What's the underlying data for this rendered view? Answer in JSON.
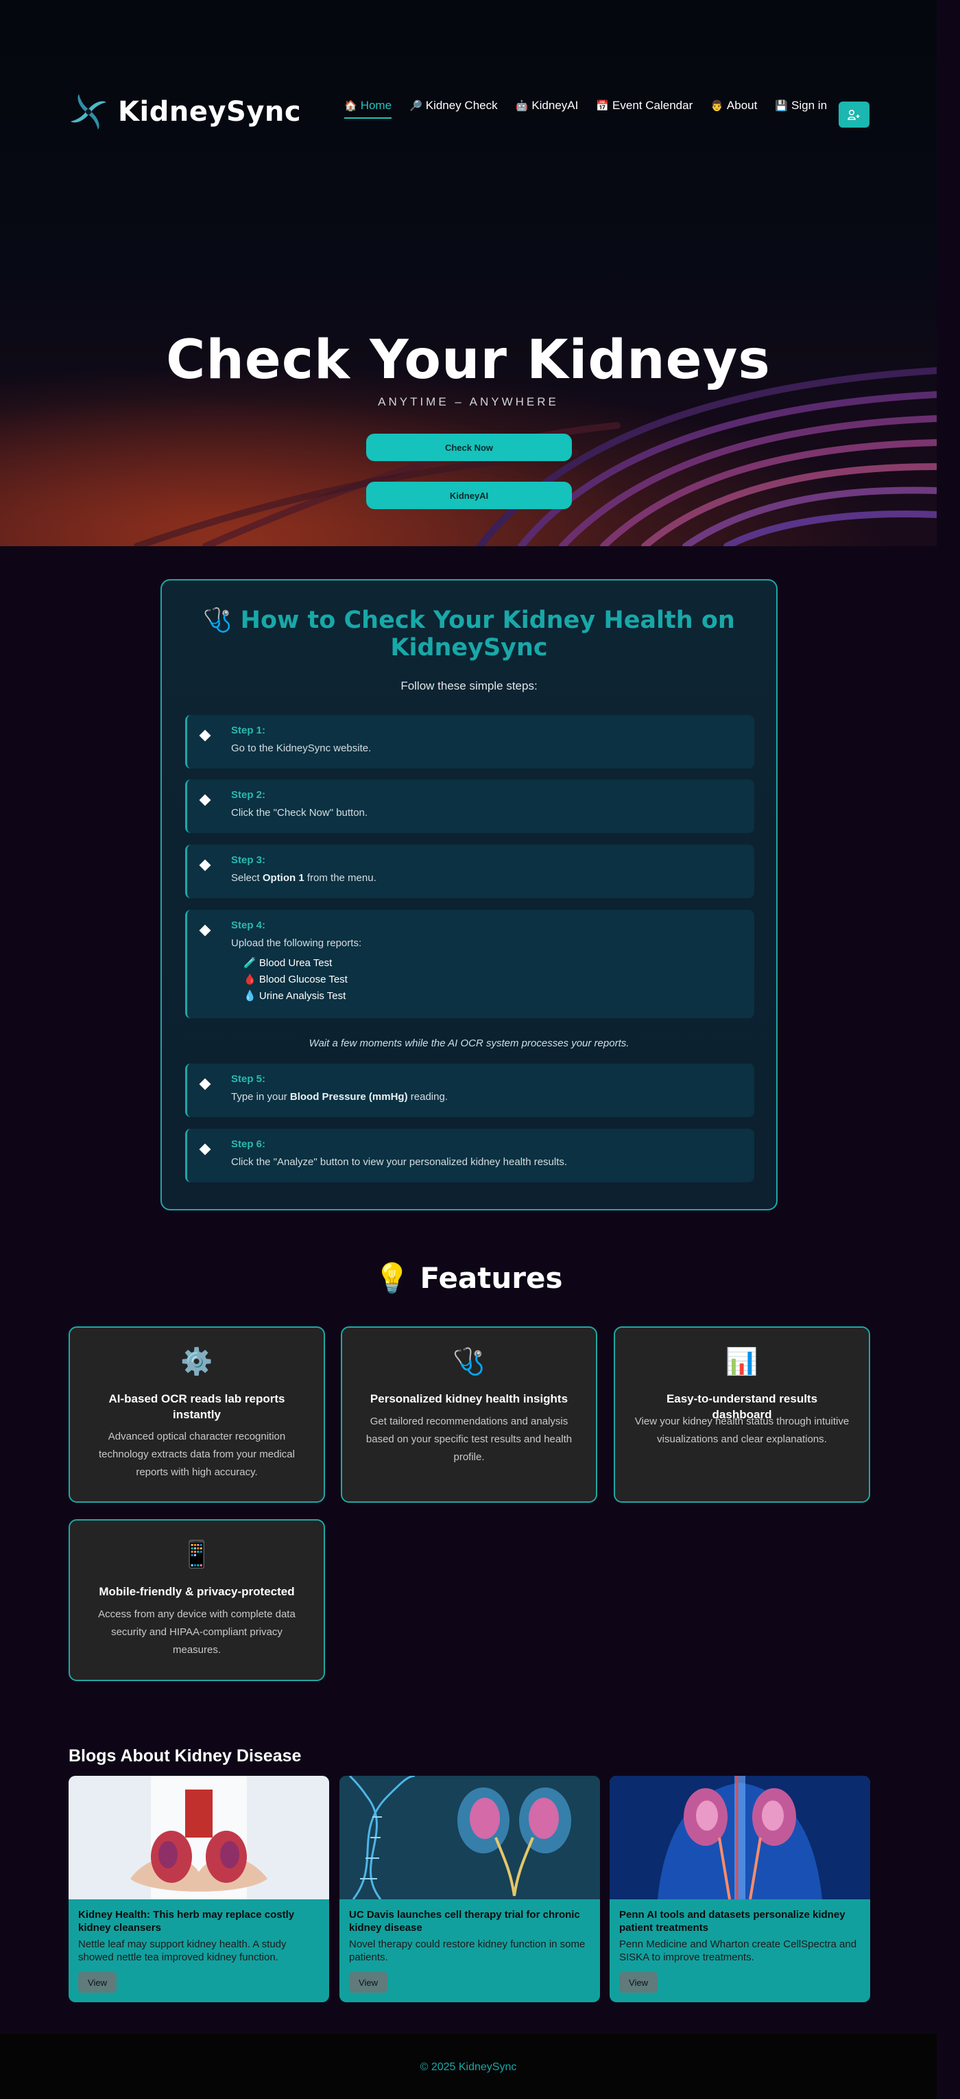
{
  "brand": {
    "name": "KidneySync",
    "accent": "#18a8a8"
  },
  "nav": {
    "items": [
      {
        "icon": "🏠",
        "label": "Home",
        "active": true
      },
      {
        "icon": "🔎",
        "label": "Kidney Check"
      },
      {
        "icon": "🤖",
        "label": "KidneyAI"
      },
      {
        "icon": "📅",
        "label": "Event Calendar"
      },
      {
        "icon": "👨",
        "label": "About"
      },
      {
        "icon": "💾",
        "label": "Sign in"
      }
    ],
    "user_button_icon": "user-add-icon"
  },
  "hero": {
    "title": "Check Your Kidneys",
    "subtitle": "ANYTIME – ANYWHERE",
    "primary_button": "Check Now",
    "secondary_button": "KidneyAI"
  },
  "howto": {
    "icon": "🩺",
    "title": "How to Check Your Kidney Health on KidneySync",
    "subtitle": "Follow these simple steps:",
    "steps": [
      {
        "label": "Step 1:",
        "text": "Go to the KidneySync website."
      },
      {
        "label": "Step 2:",
        "text": "Click the \"Check Now\" button."
      },
      {
        "label": "Step 3:",
        "text_pre": "Select ",
        "text_bold": "Option 1",
        "text_post": " from the menu."
      },
      {
        "label": "Step 4:",
        "text": "Upload the following reports:",
        "reports": [
          {
            "icon": "🧪",
            "label": "Blood Urea Test"
          },
          {
            "icon": "🩸",
            "label": "Blood Glucose Test"
          },
          {
            "icon": "💧",
            "label": "Urine Analysis Test"
          }
        ]
      },
      {
        "label": "Step 5:",
        "text_pre": "Type in your ",
        "text_bold": "Blood Pressure (mmHg)",
        "text_post": " reading."
      },
      {
        "label": "Step 6:",
        "text": "Click the \"Analyze\" button to view your personalized kidney health results."
      }
    ],
    "note": "Wait a few moments while the AI OCR system processes your reports."
  },
  "features": {
    "icon": "💡",
    "title": "Features",
    "items": [
      {
        "icon": "⚙️",
        "title": "AI-based OCR reads lab reports instantly",
        "desc": "Advanced optical character recognition technology extracts data from your medical reports with high accuracy."
      },
      {
        "icon": "🩺",
        "title": "Personalized kidney health insights",
        "desc": "Get tailored recommendations and analysis based on your specific test results and health profile."
      },
      {
        "icon": "📊",
        "title": "Easy-to-understand results dashboard",
        "desc": "View your kidney health status through intuitive visualizations and clear explanations."
      },
      {
        "icon": "📱",
        "title": "Mobile-friendly & privacy-protected",
        "desc": "Access from any device with complete data security and HIPAA-compliant privacy measures."
      }
    ]
  },
  "blogs": {
    "title": "Blogs About Kidney Disease",
    "items": [
      {
        "title": "Kidney Health: This herb may replace costly kidney cleansers",
        "desc": "Nettle leaf may support kidney health. A study showed nettle tea improved kidney function.",
        "button": "View"
      },
      {
        "title": "UC Davis launches cell therapy trial for chronic kidney disease",
        "desc": "Novel therapy could restore kidney function in some patients.",
        "button": "View"
      },
      {
        "title": "Penn AI tools and datasets personalize kidney patient treatments",
        "desc": "Penn Medicine and Wharton create CellSpectra and SISKA to improve treatments.",
        "button": "View"
      }
    ]
  },
  "footer": {
    "text": "© 2025 KidneySync"
  }
}
